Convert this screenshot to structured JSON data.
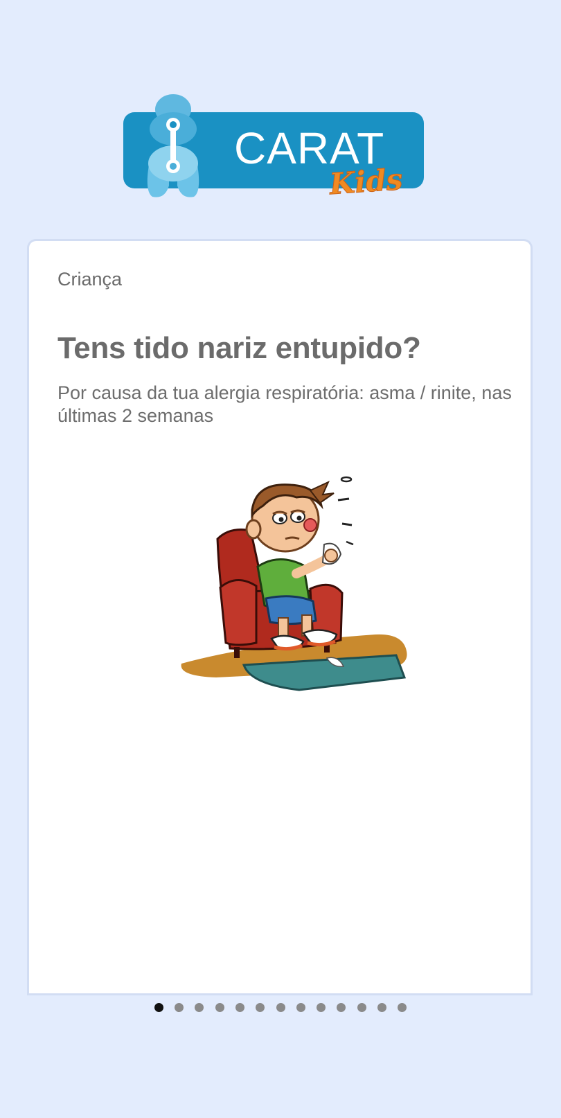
{
  "app": {
    "brand_name": "CARAT",
    "brand_sub": "Kids",
    "colors": {
      "background": "#e3ecfd",
      "brand_blue": "#1a91c3",
      "kids_orange": "#f08a22",
      "text_gray": "#6b6b6b"
    }
  },
  "card": {
    "eyebrow": "Criança",
    "question": "Tens tido nariz entupido?",
    "subtitle": "Por causa da tua alergia respiratória: asma / rinite, nas últimas 2 semanas",
    "illustration_icon": "sick-child-in-armchair-illustration"
  },
  "pagination": {
    "total": 13,
    "current": 1
  }
}
